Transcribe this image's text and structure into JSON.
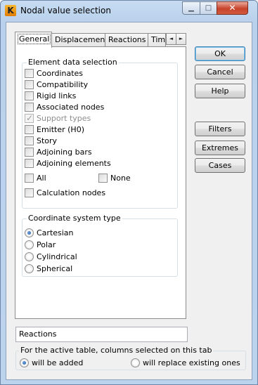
{
  "window": {
    "title": "Nodal value selection",
    "app_icon_letter": "K",
    "minimize_glyph": "▁",
    "maximize_glyph": "□",
    "close_glyph": "✕"
  },
  "tabs": [
    {
      "label": "General",
      "active": true
    },
    {
      "label": "Displacements",
      "active": false
    },
    {
      "label": "Reactions",
      "active": false
    },
    {
      "label": "Tim",
      "active": false
    }
  ],
  "tab_scroll": {
    "left": "◄",
    "right": "►"
  },
  "element_data_selection": {
    "title": "Element data selection",
    "items": [
      {
        "label": "Coordinates",
        "checked": false,
        "disabled": false
      },
      {
        "label": "Compatibility",
        "checked": false,
        "disabled": false
      },
      {
        "label": "Rigid links",
        "checked": false,
        "disabled": false
      },
      {
        "label": "Associated nodes",
        "checked": false,
        "disabled": false
      },
      {
        "label": "Support types",
        "checked": true,
        "disabled": true
      },
      {
        "label": "Emitter (H0)",
        "checked": false,
        "disabled": false
      },
      {
        "label": "Story",
        "checked": false,
        "disabled": false
      },
      {
        "label": "Adjoining bars",
        "checked": false,
        "disabled": false
      },
      {
        "label": "Adjoining elements",
        "checked": false,
        "disabled": false
      }
    ],
    "all_label": "All",
    "none_label": "None",
    "calculation_nodes_label": "Calculation nodes"
  },
  "coordinate_system": {
    "title": "Coordinate system type",
    "options": [
      {
        "label": "Cartesian",
        "selected": true
      },
      {
        "label": "Polar",
        "selected": false
      },
      {
        "label": "Cylindrical",
        "selected": false
      },
      {
        "label": "Spherical",
        "selected": false
      }
    ]
  },
  "buttons": {
    "ok": "OK",
    "cancel": "Cancel",
    "help": "Help",
    "filters": "Filters",
    "extremes": "Extremes",
    "cases": "Cases"
  },
  "table_name_value": "Reactions",
  "active_table": {
    "title": "For the active table, columns selected on this tab",
    "options": [
      {
        "label": "will be added",
        "selected": true
      },
      {
        "label": "will replace existing ones",
        "selected": false
      }
    ]
  }
}
